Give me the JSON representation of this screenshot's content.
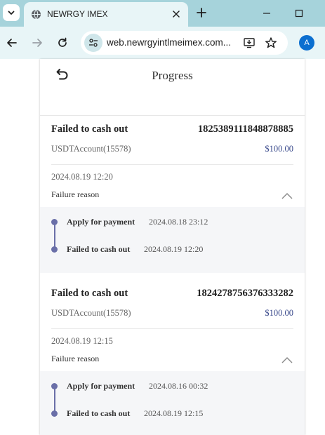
{
  "browser": {
    "tab_title": "NEWRGY IMEX",
    "url": "web.newrgyintlmeimex.com...",
    "profile_initial": "A"
  },
  "page": {
    "title": "Progress"
  },
  "records": [
    {
      "status": "Failed to cash out",
      "order_no": "1825389111848878885",
      "account": "USDTAccount(15578)",
      "amount": "$100.00",
      "time": "2024.08.19 12:20",
      "reason_label": "Failure reason",
      "steps": [
        {
          "name": "Apply for payment",
          "time": "2024.08.18 23:12"
        },
        {
          "name": "Failed to cash out",
          "time": "2024.08.19 12:20"
        }
      ]
    },
    {
      "status": "Failed to cash out",
      "order_no": "1824278756376333282",
      "account": "USDTAccount(15578)",
      "amount": "$100.00",
      "time": "2024.08.19 12:15",
      "reason_label": "Failure reason",
      "steps": [
        {
          "name": "Apply for payment",
          "time": "2024.08.16 00:32"
        },
        {
          "name": "Failed to cash out",
          "time": "2024.08.19 12:15"
        }
      ]
    }
  ],
  "colors": {
    "tabbar": "#a6d3db",
    "toolbar": "#e8f5f7",
    "accent_amount": "#3a4a8c",
    "timeline": "#6a6fa8",
    "timeline_bg": "#f5f6f8"
  },
  "icons": [
    "tab-search-icon",
    "globe-icon",
    "close-icon",
    "plus-icon",
    "minimize-icon",
    "maximize-icon",
    "back-arrow-icon",
    "forward-arrow-icon",
    "reload-icon",
    "site-settings-icon",
    "install-app-icon",
    "bookmark-star-icon",
    "undo-back-icon",
    "chevron-up-icon"
  ]
}
